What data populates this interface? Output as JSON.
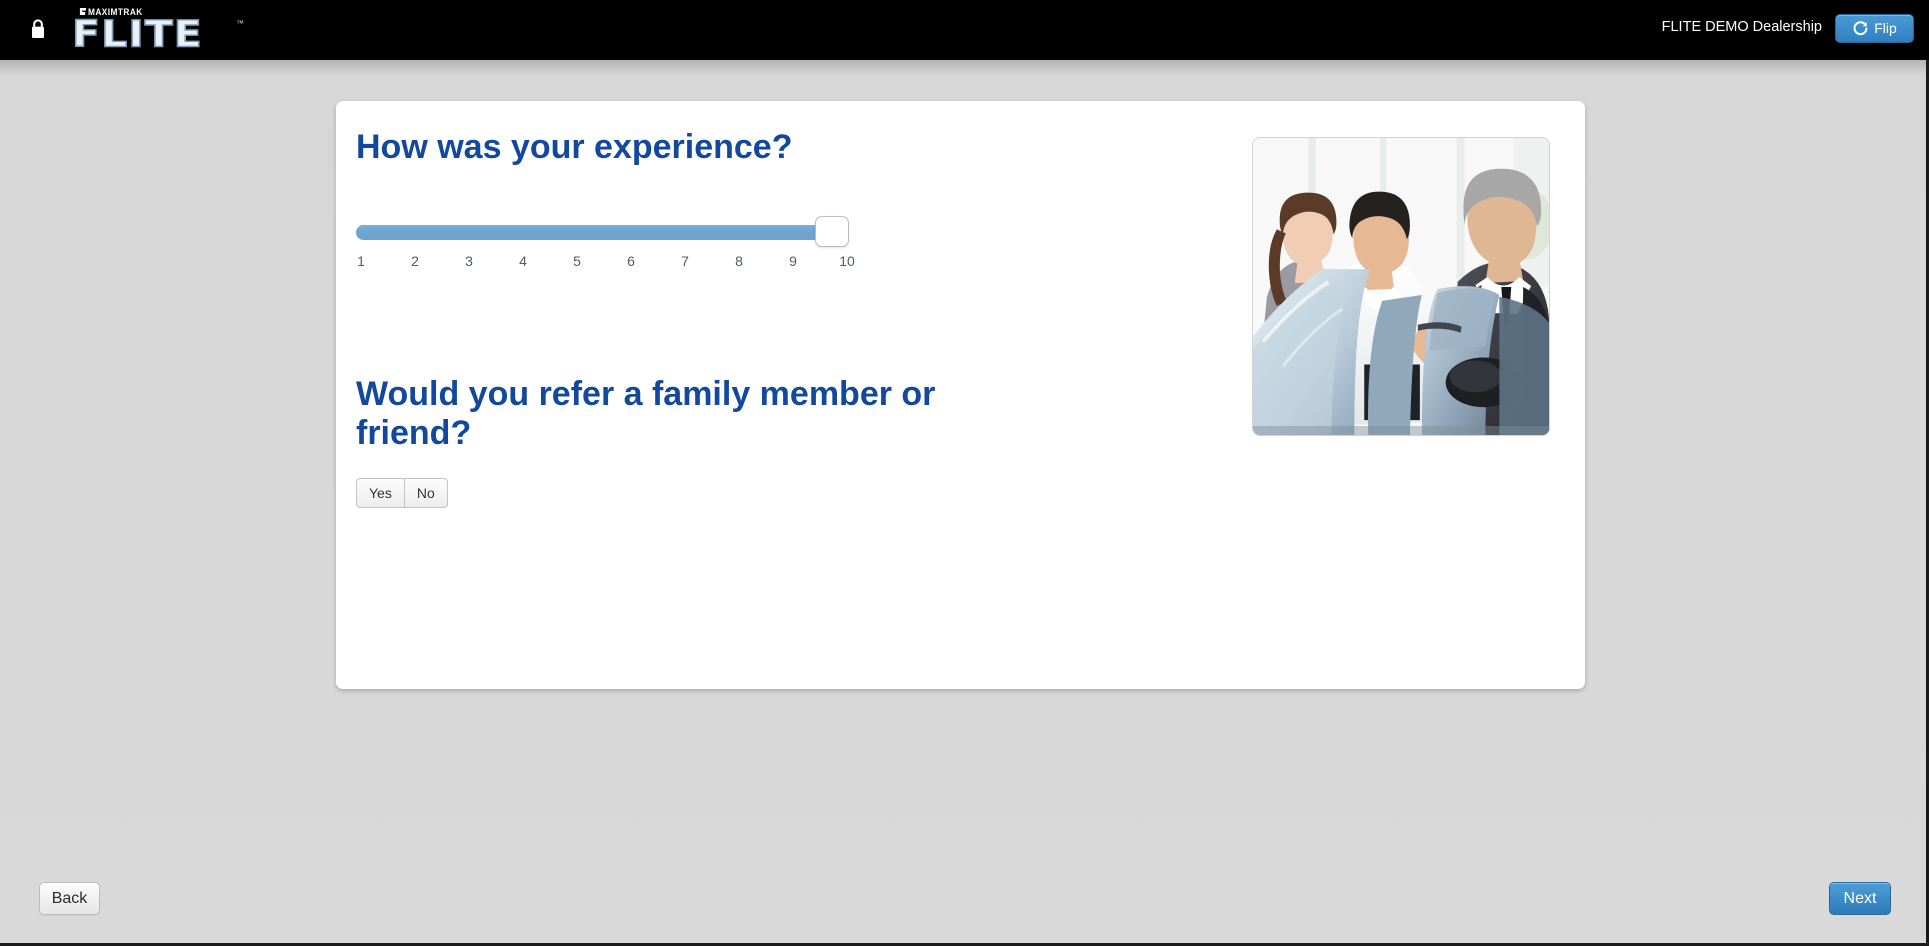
{
  "topbar": {
    "lock_icon": "lock-icon",
    "brand_sup": "MAXIMTRAK",
    "brand_word": "FLITE",
    "brand_tm": "™",
    "dealership": "FLITE DEMO Dealership",
    "flip_button": {
      "label": "Flip",
      "icon": "refresh-icon"
    },
    "background_color": "#000000"
  },
  "survey": {
    "question_1": {
      "title": "How was your experience?",
      "control": "slider",
      "scale_min": 1,
      "scale_max": 10,
      "current_value": 10,
      "ticks": [
        "1",
        "2",
        "3",
        "4",
        "5",
        "6",
        "7",
        "8",
        "9",
        "10"
      ],
      "fill_color": "#6da5cf",
      "title_color": "#12489d"
    },
    "question_2": {
      "title": "Would you refer a family member or friend?",
      "control": "button-group",
      "options": [
        {
          "label": "Yes",
          "selected": false
        },
        {
          "label": "No",
          "selected": false
        }
      ],
      "title_color": "#12489d"
    },
    "photo": {
      "alt": "Salesperson greeting a couple beside a car at a dealership",
      "name": "dealership-photo"
    }
  },
  "footer": {
    "back_label": "Back",
    "next_label": "Next",
    "next_color": "#2e7cba"
  }
}
